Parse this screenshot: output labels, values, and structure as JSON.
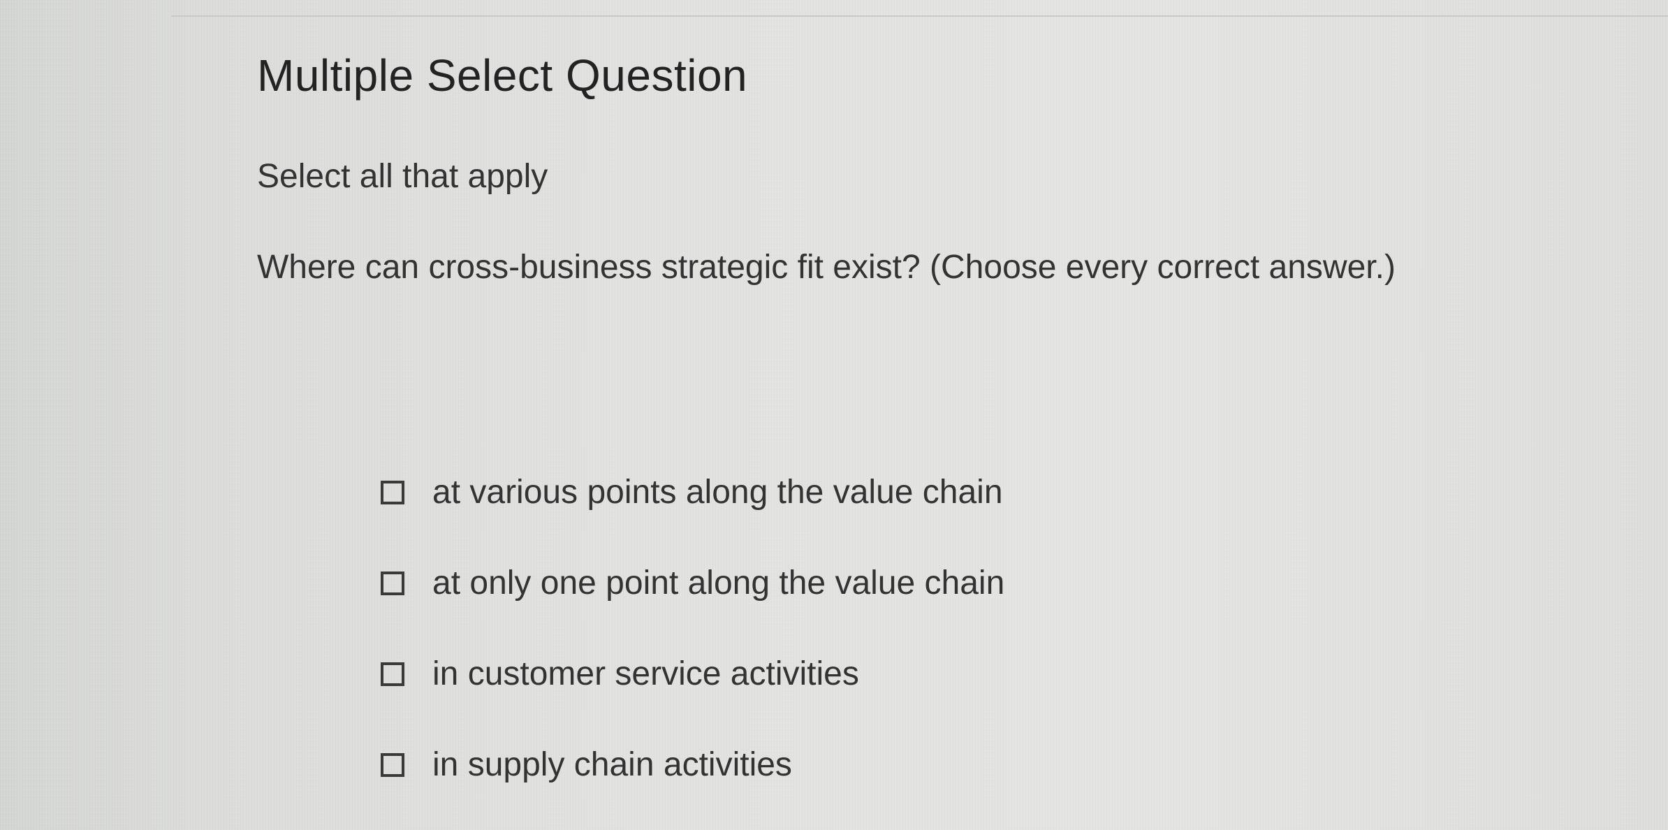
{
  "question": {
    "type_label": "Multiple Select Question",
    "instruction": "Select all that apply",
    "prompt": "Where can cross-business strategic fit exist? (Choose every correct answer.)"
  },
  "options": [
    {
      "label": "at various points along the value chain",
      "checked": false
    },
    {
      "label": "at only one point along the value chain",
      "checked": false
    },
    {
      "label": "in customer service activities",
      "checked": false
    },
    {
      "label": "in supply chain activities",
      "checked": false
    }
  ],
  "colors": {
    "text": "#333333",
    "checkbox_border": "#3a3a3a",
    "background": "#e2e2e0"
  }
}
